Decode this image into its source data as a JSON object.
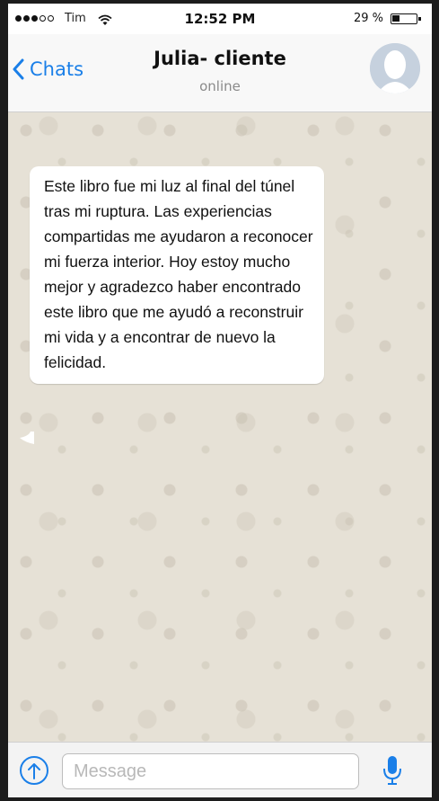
{
  "status_bar": {
    "carrier": "Tim",
    "time": "12:52 PM",
    "battery_percent": "29 %",
    "battery_level": 0.29,
    "signal_bars": 3,
    "signal_max": 5
  },
  "nav": {
    "back_label": "Chats",
    "contact_name": "Julia- cliente",
    "contact_status": "online"
  },
  "messages": [
    {
      "direction": "incoming",
      "text": "Este libro fue mi luz al final del túnel tras mi ruptura. Las experiencias compartidas me ayudaron a reconocer mi fuerza interior. Hoy estoy mucho mejor y agradezco haber encontrado este libro que me ayudó a reconstruir mi vida y a encontrar de nuevo la felicidad."
    }
  ],
  "input": {
    "placeholder": "Message",
    "value": ""
  },
  "colors": {
    "accent": "#1a7fe8",
    "chat_background": "#e6e1d6",
    "bubble": "#ffffff"
  },
  "icons": [
    "signal-dots-icon",
    "wifi-icon",
    "battery-icon",
    "chevron-left-icon",
    "avatar-placeholder-icon",
    "upload-arrow-icon",
    "microphone-icon"
  ]
}
